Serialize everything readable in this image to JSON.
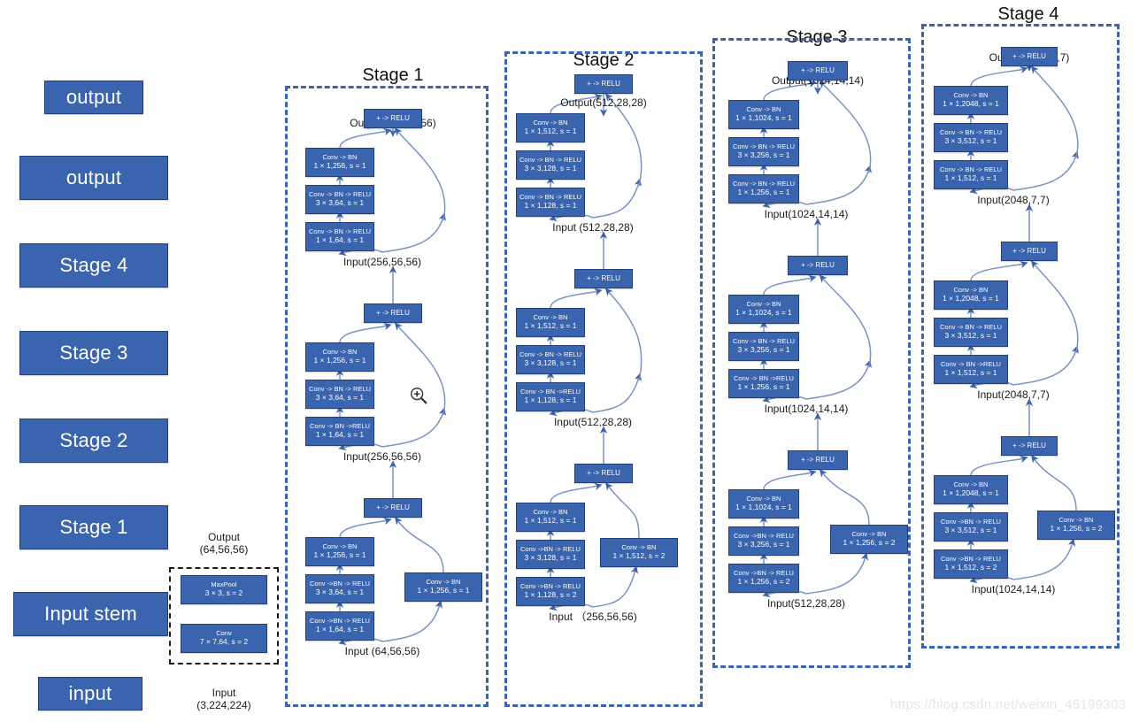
{
  "watermark": "https://blog.csdn.net/weixin_45199303",
  "colors": {
    "block_fill": "#3a64ae",
    "block_border": "#22407a",
    "dash_blue": "#3a64ae",
    "dash_black": "#1c1c1c",
    "text_dark": "#1a1a1a"
  },
  "overview": {
    "blocks": [
      {
        "label": "output"
      },
      {
        "label": "output"
      },
      {
        "label": "Stage 4"
      },
      {
        "label": "Stage 3"
      },
      {
        "label": "Stage 2"
      },
      {
        "label": "Stage 1"
      },
      {
        "label": "Input stem"
      },
      {
        "label": "input"
      }
    ]
  },
  "input_stem": {
    "output_label_line1": "Output",
    "output_label_line2": "(64,56,56)",
    "input_label_line1": "Input",
    "input_label_line2": "(3,224,224)",
    "blocks": [
      {
        "l1": "MaxPool",
        "l2": "3 × 3, s = 2"
      },
      {
        "l1": "Conv",
        "l2": "7 × 7,64, s = 2"
      }
    ]
  },
  "stages": [
    {
      "title": "Stage 1",
      "output_label": "Output(256,56,56)",
      "bottom_input_label": "Input (64,56,56)",
      "residual_blocks": [
        {
          "io_top": "Output(256,56,56)",
          "io_bottom": "Input(256,56,56)",
          "add": "+ -> RELU",
          "convs": [
            {
              "l1": "Conv -> BN",
              "l2": "1 × 1,256, s = 1"
            },
            {
              "l1": "Conv -> BN -> RELU",
              "l2": "3 × 3,64, s = 1"
            },
            {
              "l1": "Conv -> BN -> RELU",
              "l2": "1 × 1,64, s = 1"
            }
          ],
          "shortcut": null
        },
        {
          "io_top": "Input(256,56,56)",
          "io_bottom": "Input(256,56,56)",
          "add": "+ -> RELU",
          "convs": [
            {
              "l1": "Conv -> BN",
              "l2": "1 × 1,256, s = 1"
            },
            {
              "l1": "Conv -> BN -> RELU",
              "l2": "3 × 3,64, s = 1"
            },
            {
              "l1": "Conv -> BN ->RELU",
              "l2": "1 × 1,64, s = 1"
            }
          ],
          "shortcut": null
        },
        {
          "io_top": "Input(256,56,56)",
          "io_bottom": "Input (64,56,56)",
          "add": "+ -> RELU",
          "convs": [
            {
              "l1": "Conv -> BN",
              "l2": "1 × 1,256, s = 1"
            },
            {
              "l1": "Conv ->BN -> RELU",
              "l2": "3 × 3,64, s = 1"
            },
            {
              "l1": "Conv ->BN -> RELU",
              "l2": "1 × 1,64, s = 1"
            }
          ],
          "shortcut": {
            "l1": "Conv -> BN",
            "l2": "1 × 1,256, s = 1"
          }
        }
      ]
    },
    {
      "title": "Stage 2",
      "output_label": "Output(512,28,28)",
      "bottom_input_label": "Input （256,56,56)",
      "residual_blocks": [
        {
          "io_top": "Output(512,28,28)",
          "io_bottom": "Input (512,28,28)",
          "add": "+ -> RELU",
          "convs": [
            {
              "l1": "Conv -> BN",
              "l2": "1 × 1,512, s = 1"
            },
            {
              "l1": "Conv -> BN -> RELU",
              "l2": "3 × 3,128, s = 1"
            },
            {
              "l1": "Conv -> BN -> RELU",
              "l2": "1 × 1,128, s = 1"
            }
          ],
          "shortcut": null
        },
        {
          "io_top": "Input (512,28,28)",
          "io_bottom": "Input(512,28,28)",
          "add": "+ -> RELU",
          "convs": [
            {
              "l1": "Conv -> BN",
              "l2": "1 × 1,512, s = 1"
            },
            {
              "l1": "Conv -> BN -> RELU",
              "l2": "3 × 3,128, s = 1"
            },
            {
              "l1": "Conv -> BN ->RELU",
              "l2": "1 × 1,128, s = 1"
            }
          ],
          "shortcut": null
        },
        {
          "io_top": "Input(512,28,28)",
          "io_bottom": "Input （256,56,56)",
          "add": "+ -> RELU",
          "convs": [
            {
              "l1": "Conv -> BN",
              "l2": "1 × 1,512, s = 1"
            },
            {
              "l1": "Conv ->BN -> RELU",
              "l2": "3 × 3,128, s = 1"
            },
            {
              "l1": "Conv ->BN -> RELU",
              "l2": "1 × 1,128, s = 2"
            }
          ],
          "shortcut": {
            "l1": "Conv -> BN",
            "l2": "1 × 1,512, s = 2"
          }
        }
      ]
    },
    {
      "title": "Stage 3",
      "output_label": "Output(1024,14,14)",
      "bottom_input_label": "Input(512,28,28)",
      "residual_blocks": [
        {
          "io_top": "Output(1024,14,14)",
          "io_bottom": "Input(1024,14,14)",
          "add": "+ -> RELU",
          "convs": [
            {
              "l1": "Conv -> BN",
              "l2": "1 × 1,1024, s = 1"
            },
            {
              "l1": "Conv -> BN -> RELU",
              "l2": "3 × 3,256, s = 1"
            },
            {
              "l1": "Conv -> BN -> RELU",
              "l2": "1 × 1,256, s = 1"
            }
          ],
          "shortcut": null
        },
        {
          "io_top": "Input(1024,14,14)",
          "io_bottom": "Input(1024,14,14)",
          "add": "+ -> RELU",
          "convs": [
            {
              "l1": "Conv -> BN",
              "l2": "1 × 1,1024, s = 1"
            },
            {
              "l1": "Conv -> BN -> RELU",
              "l2": "3 × 3,256, s = 1"
            },
            {
              "l1": "Conv -> BN ->RELU",
              "l2": "1 × 1,256, s = 1"
            }
          ],
          "shortcut": null
        },
        {
          "io_top": "Input(1024,14,14)",
          "io_bottom": "Input(512,28,28)",
          "add": "+ -> RELU",
          "convs": [
            {
              "l1": "Conv -> BN",
              "l2": "1 × 1,1024, s = 1"
            },
            {
              "l1": "Conv ->BN -> RELU",
              "l2": "3 × 3,256, s = 1"
            },
            {
              "l1": "Conv ->BN -> RELU",
              "l2": "1 × 1,256, s = 2"
            }
          ],
          "shortcut": {
            "l1": "Conv -> BN",
            "l2": "1 × 1,256, s = 2"
          }
        }
      ]
    },
    {
      "title": "Stage 4",
      "output_label": "Output(2048,7,7)",
      "bottom_input_label": "Input(1024,14,14)",
      "residual_blocks": [
        {
          "io_top": "Output(2048,7,7)",
          "io_bottom": "Input(2048,7,7)",
          "add": "+ -> RELU",
          "convs": [
            {
              "l1": "Conv -> BN",
              "l2": "1 × 1,2048, s = 1"
            },
            {
              "l1": "Conv -> BN -> RELU",
              "l2": "3 × 3,512, s = 1"
            },
            {
              "l1": "Conv -> BN -> RELU",
              "l2": "1 × 1,512, s = 1"
            }
          ],
          "shortcut": null
        },
        {
          "io_top": "Input(2048,7,7)",
          "io_bottom": "Input(2048,7,7)",
          "add": "+ -> RELU",
          "convs": [
            {
              "l1": "Conv -> BN",
              "l2": "1 × 1,2048, s = 1"
            },
            {
              "l1": "Conv -> BN -> RELU",
              "l2": "3 × 3,512, s = 1"
            },
            {
              "l1": "Conv -> BN ->RELU",
              "l2": "1 × 1,512, s = 1"
            }
          ],
          "shortcut": null
        },
        {
          "io_top": "Input(2048,7,7)",
          "io_bottom": "Input(1024,14,14)",
          "add": "+ -> RELU",
          "convs": [
            {
              "l1": "Conv -> BN",
              "l2": "1 × 1,2048, s = 1"
            },
            {
              "l1": "Conv ->BN -> RELU",
              "l2": "3 × 3,512, s = 1"
            },
            {
              "l1": "Conv ->BN -> RELU",
              "l2": "1 × 1,512, s = 2"
            }
          ],
          "shortcut": {
            "l1": "Conv -> BN",
            "l2": "1 × 1,256, s = 2"
          }
        }
      ]
    }
  ]
}
